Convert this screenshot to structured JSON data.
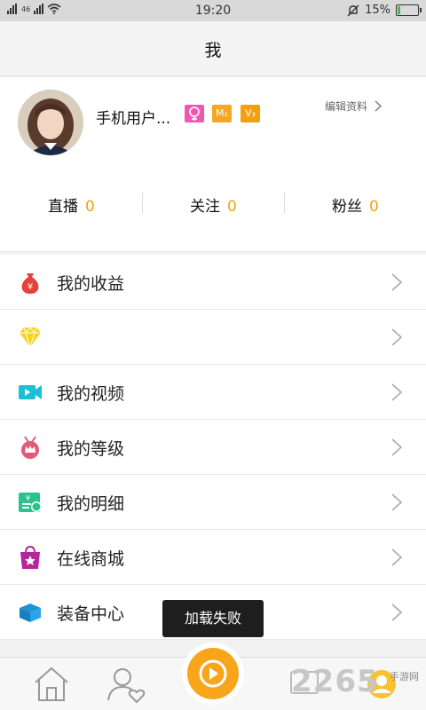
{
  "status_bar": {
    "signal_label": "46",
    "time": "19:20",
    "battery_percent": "15%",
    "battery_level": 0.15
  },
  "header": {
    "title": "我"
  },
  "profile": {
    "username": "手机用户...",
    "badges": [
      "",
      "M₁",
      "V₃"
    ],
    "edit_label": "编辑资料",
    "stats": [
      {
        "label": "直播",
        "value": "0"
      },
      {
        "label": "关注",
        "value": "0"
      },
      {
        "label": "粉丝",
        "value": "0"
      }
    ]
  },
  "menu": {
    "items": [
      {
        "label": "我的收益",
        "icon": "money-bag-icon"
      },
      {
        "label": "",
        "icon": "diamond-icon"
      },
      {
        "label": "我的视频",
        "icon": "video-camera-icon"
      },
      {
        "label": "我的等级",
        "icon": "crown-medal-icon"
      },
      {
        "label": "我的明细",
        "icon": "bill-icon"
      },
      {
        "label": "在线商城",
        "icon": "shopping-bag-icon"
      },
      {
        "label": "装备中心",
        "icon": "box-icon"
      }
    ]
  },
  "toast": {
    "message": "加载失败"
  },
  "tab_bar": {
    "items": [
      "home-icon",
      "user-follow-icon",
      "play-icon",
      "notification-icon",
      "profile-icon"
    ]
  },
  "watermark": {
    "text": "2265",
    "sub": "手游网"
  },
  "colors": {
    "accent": "#f0a30a",
    "toast_bg": "#1e1e1e",
    "badge_pink": "#f057b3",
    "badge_orange": "#f5a623"
  }
}
